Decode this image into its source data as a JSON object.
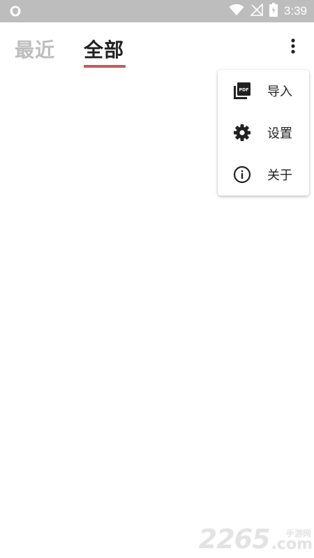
{
  "status_bar": {
    "time": "3:39",
    "icons": [
      "shield-icon",
      "wifi-icon",
      "no-signal-icon",
      "battery-charging-icon"
    ]
  },
  "tabs": [
    {
      "label": "最近",
      "selected": false
    },
    {
      "label": "全部",
      "selected": true
    }
  ],
  "colors": {
    "status_bar": "#bdbdbd",
    "tab_inactive": "#bdbdbd",
    "tab_active": "#212121",
    "indicator": "#c75b5b"
  },
  "overflow_menu": {
    "icon": "more-vert-icon",
    "items": [
      {
        "label": "导入",
        "icon": "pdf-icon"
      },
      {
        "label": "设置",
        "icon": "gear-icon"
      },
      {
        "label": "关于",
        "icon": "info-icon"
      }
    ]
  },
  "watermark": {
    "number": "2265",
    "suffix_cn": "手游网",
    "suffix": ".com"
  }
}
